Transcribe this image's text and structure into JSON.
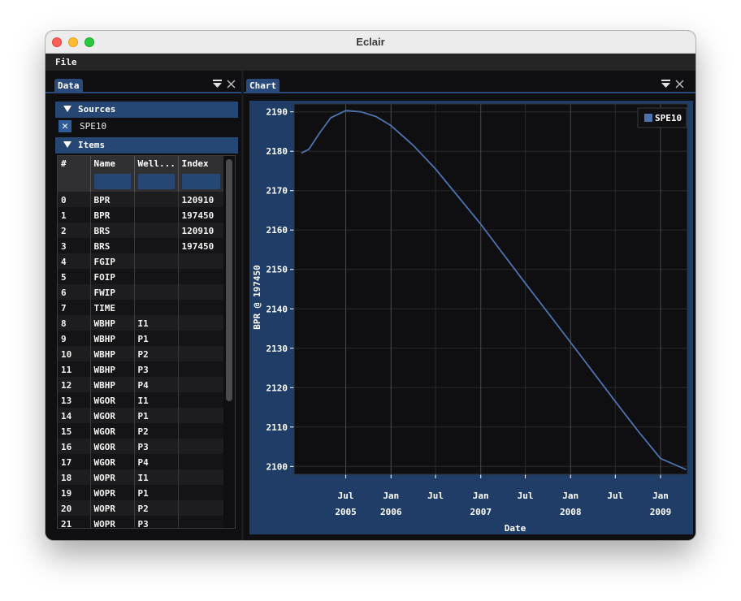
{
  "window": {
    "title": "Eclair"
  },
  "menu": {
    "file": "File"
  },
  "data_panel": {
    "tab": "Data",
    "filter_icon": "filter-icon",
    "close_icon": "close-icon",
    "sources": {
      "header": "Sources",
      "items": [
        {
          "label": "SPE10",
          "checked": true,
          "check_glyph": "✕"
        }
      ]
    },
    "items": {
      "header": "Items",
      "columns": [
        "#",
        "Name",
        "Well...",
        "Index"
      ],
      "rows": [
        [
          "0",
          "BPR",
          "",
          "120910"
        ],
        [
          "1",
          "BPR",
          "",
          "197450"
        ],
        [
          "2",
          "BRS",
          "",
          "120910"
        ],
        [
          "3",
          "BRS",
          "",
          "197450"
        ],
        [
          "4",
          "FGIP",
          "",
          ""
        ],
        [
          "5",
          "FOIP",
          "",
          ""
        ],
        [
          "6",
          "FWIP",
          "",
          ""
        ],
        [
          "7",
          "TIME",
          "",
          ""
        ],
        [
          "8",
          "WBHP",
          "I1",
          ""
        ],
        [
          "9",
          "WBHP",
          "P1",
          ""
        ],
        [
          "10",
          "WBHP",
          "P2",
          ""
        ],
        [
          "11",
          "WBHP",
          "P3",
          ""
        ],
        [
          "12",
          "WBHP",
          "P4",
          ""
        ],
        [
          "13",
          "WGOR",
          "I1",
          ""
        ],
        [
          "14",
          "WGOR",
          "P1",
          ""
        ],
        [
          "15",
          "WGOR",
          "P2",
          ""
        ],
        [
          "16",
          "WGOR",
          "P3",
          ""
        ],
        [
          "17",
          "WGOR",
          "P4",
          ""
        ],
        [
          "18",
          "WOPR",
          "I1",
          ""
        ],
        [
          "19",
          "WOPR",
          "P1",
          ""
        ],
        [
          "20",
          "WOPR",
          "P2",
          ""
        ],
        [
          "21",
          "WOPR",
          "P3",
          ""
        ]
      ]
    }
  },
  "chart_panel": {
    "tab": "Chart",
    "filter_icon": "filter-icon",
    "close_icon": "close-icon"
  },
  "colors": {
    "accent": "#294a7a",
    "plot_bg": "#0f0f11",
    "frame_bg": "#1f3d66",
    "series": "#4c72b0",
    "grid": "#2a2a2c"
  },
  "chart_data": {
    "type": "line",
    "xlabel": "Date",
    "ylabel": "BPR @ 197450",
    "ylim": [
      2098,
      2192
    ],
    "yticks": [
      2100,
      2110,
      2120,
      2130,
      2140,
      2150,
      2160,
      2170,
      2180,
      2190
    ],
    "xlim": [
      "2004-12-03",
      "2009-04-20"
    ],
    "xticks": [
      {
        "date": "2005-07-01",
        "label": "Jul",
        "year": "2005"
      },
      {
        "date": "2006-01-01",
        "label": "Jan",
        "year": "2006"
      },
      {
        "date": "2006-07-01",
        "label": "Jul",
        "year": ""
      },
      {
        "date": "2007-01-01",
        "label": "Jan",
        "year": "2007"
      },
      {
        "date": "2007-07-01",
        "label": "Jul",
        "year": ""
      },
      {
        "date": "2008-01-01",
        "label": "Jan",
        "year": "2008"
      },
      {
        "date": "2008-07-01",
        "label": "Jul",
        "year": ""
      },
      {
        "date": "2009-01-01",
        "label": "Jan",
        "year": "2009"
      }
    ],
    "grid": true,
    "legend": "top-right",
    "series": [
      {
        "name": "SPE10",
        "x": [
          "2005-01-01",
          "2005-02-01",
          "2005-03-15",
          "2005-05-01",
          "2005-07-01",
          "2005-09-01",
          "2005-11-01",
          "2006-01-01",
          "2006-04-01",
          "2006-07-01",
          "2006-10-01",
          "2007-01-01",
          "2007-04-01",
          "2007-07-01",
          "2007-10-01",
          "2008-01-01",
          "2008-04-01",
          "2008-07-01",
          "2008-10-01",
          "2009-01-01",
          "2009-04-15"
        ],
        "y": [
          2179.5,
          2180.5,
          2184.5,
          2188.5,
          2190.3,
          2190.0,
          2188.8,
          2186.5,
          2181.5,
          2175.5,
          2168.5,
          2161.5,
          2154.0,
          2146.5,
          2139.0,
          2131.5,
          2124.0,
          2116.5,
          2109.0,
          2102.0,
          2099.2
        ]
      }
    ]
  }
}
